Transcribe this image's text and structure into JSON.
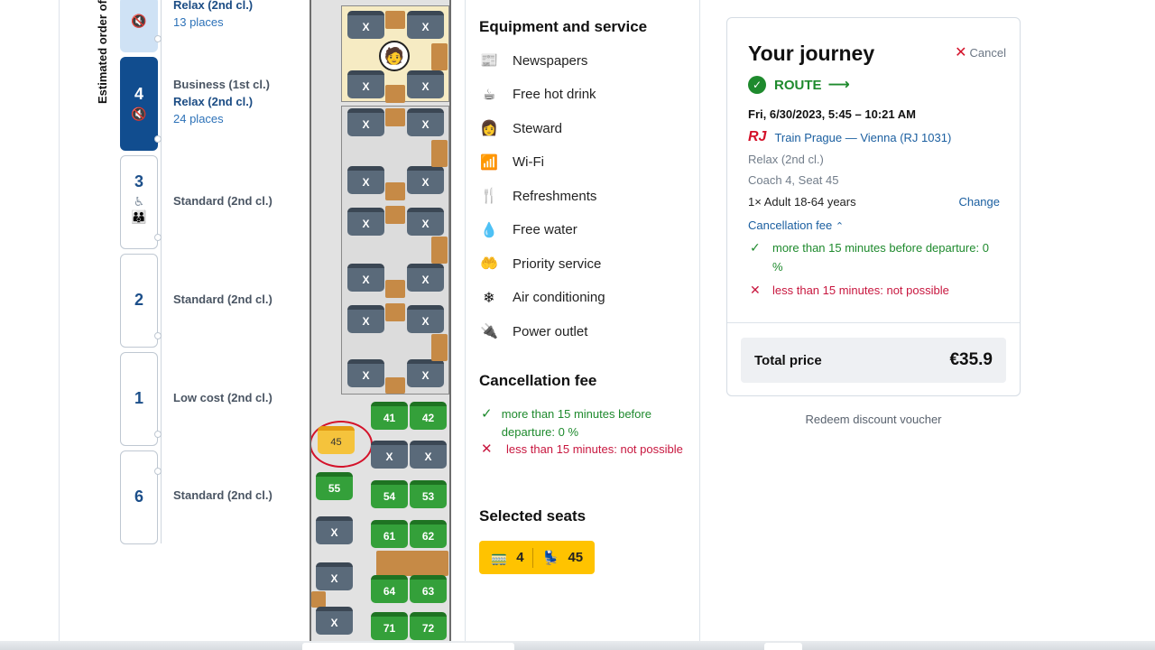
{
  "coaches": {
    "rail_label": "Estimated order of coaches",
    "items": [
      {
        "number": "",
        "class1": "",
        "class2": "Relax (2nd cl.)",
        "places": "13 places",
        "icons": [
          "quiet-zone-icon"
        ]
      },
      {
        "number": "4",
        "class1": "Business (1st cl.)",
        "class2": "Relax (2nd cl.)",
        "places": "24 places",
        "icons": [
          "quiet-zone-icon"
        ]
      },
      {
        "number": "3",
        "class1": "Standard (2nd cl.)",
        "icons": [
          "wheelchair-icon",
          "family-icon"
        ]
      },
      {
        "number": "2",
        "class1": "Standard (2nd cl.)"
      },
      {
        "number": "1",
        "class1": "Low cost (2nd cl.)"
      },
      {
        "number": "6",
        "class1": "Standard (2nd cl.)"
      }
    ]
  },
  "seat_map": {
    "taken_mark": "X",
    "free_seats": [
      "41",
      "42",
      "54",
      "53",
      "55",
      "61",
      "62",
      "64",
      "63",
      "71",
      "72"
    ],
    "selected_seat": "45"
  },
  "equipment": {
    "heading": "Equipment and service",
    "items": [
      {
        "icon": "newspaper-icon",
        "label": "Newspapers"
      },
      {
        "icon": "hot-drink-icon",
        "label": "Free hot drink"
      },
      {
        "icon": "steward-icon",
        "label": "Steward"
      },
      {
        "icon": "wifi-icon",
        "label": "Wi-Fi"
      },
      {
        "icon": "cutlery-icon",
        "label": "Refreshments"
      },
      {
        "icon": "water-icon",
        "label": "Free water"
      },
      {
        "icon": "priority-icon",
        "label": "Priority service"
      },
      {
        "icon": "snowflake-icon",
        "label": "Air conditioning"
      },
      {
        "icon": "plug-icon",
        "label": "Power outlet"
      }
    ]
  },
  "cancellation": {
    "heading": "Cancellation fee",
    "ok_text": "more than 15 minutes before departure: 0 %",
    "no_text": "less than 15 minutes: not possible"
  },
  "selected_seats": {
    "heading": "Selected seats",
    "coach": "4",
    "seat": "45"
  },
  "journey": {
    "cancel": "Cancel",
    "title": "Your journey",
    "route": "ROUTE",
    "datetime": "Fri, 6/30/2023, 5:45 – 10:21 AM",
    "operator": "RJ",
    "train": "Train Prague — Vienna (RJ 1031)",
    "fare_class": "Relax (2nd cl.)",
    "coach_seat": "Coach 4, Seat 45",
    "passenger": "1× Adult 18-64 years",
    "change": "Change",
    "cancellation_label": "Cancellation fee",
    "ok_text": "more than 15 minutes before departure: 0 %",
    "no_text": "less than 15 minutes: not possible",
    "total_label": "Total price",
    "total_value": "€35.9"
  },
  "voucher": "Redeem discount voucher",
  "colors": {
    "accent": "#114d8f",
    "green": "#1e8a2d",
    "red": "#c8173f",
    "seat_selected": "#f5c33c"
  }
}
